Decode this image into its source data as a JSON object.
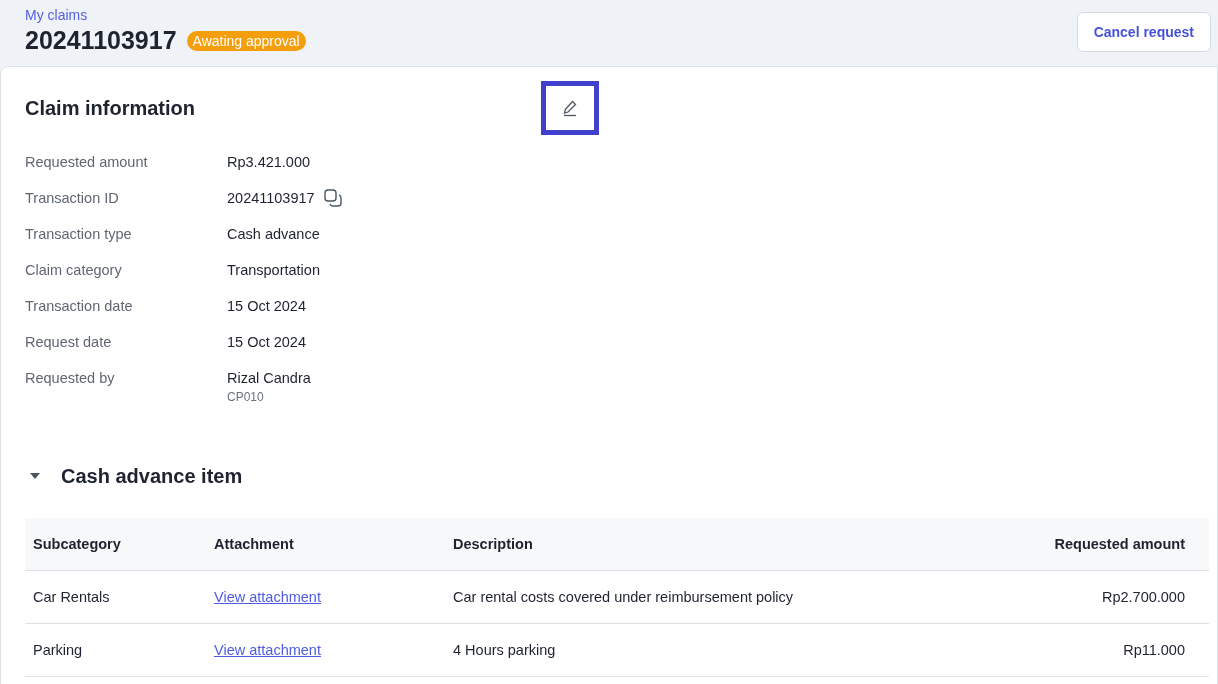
{
  "header": {
    "breadcrumb": "My claims",
    "title": "20241103917",
    "status": "Awating approval",
    "cancel_button": "Cancel request"
  },
  "claim_information": {
    "title": "Claim information",
    "edit_button": {
      "focused": true
    },
    "fields": [
      {
        "label": "Requested amount",
        "value": "Rp3.421.000"
      },
      {
        "label": "Transaction ID",
        "value": "20241103917",
        "copyable": true
      },
      {
        "label": "Transaction type",
        "value": "Cash advance"
      },
      {
        "label": "Claim category",
        "value": "Transportation"
      },
      {
        "label": "Transaction date",
        "value": "15 Oct 2024"
      },
      {
        "label": "Request date",
        "value": "15 Oct 2024"
      },
      {
        "label": "Requested by",
        "value": "Rizal Candra",
        "subvalue": "CP010"
      }
    ]
  },
  "cash_advance_items": {
    "title": "Cash advance item",
    "expanded": true,
    "columns": [
      "Subcategory",
      "Attachment",
      "Description",
      "Requested amount"
    ],
    "rows": [
      {
        "subcategory": "Car Rentals",
        "attachment": "View attachment",
        "description": "Car rental costs covered under reimbursement policy",
        "amount": "Rp2.700.000"
      },
      {
        "subcategory": "Parking",
        "attachment": "View attachment",
        "description": "4 Hours parking",
        "amount": "Rp11.000"
      }
    ]
  }
}
